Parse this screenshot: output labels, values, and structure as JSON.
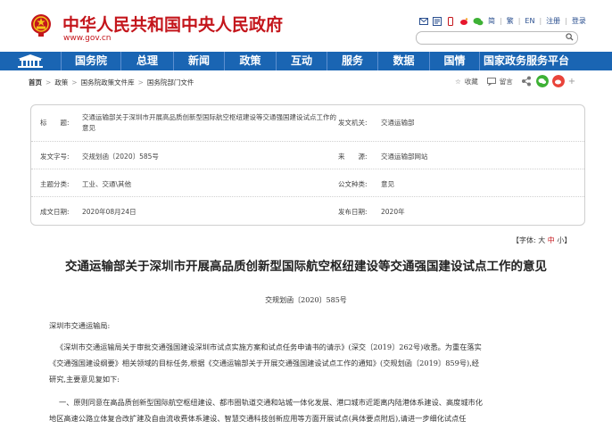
{
  "header": {
    "site_title": "中华人民共和国中央人民政府",
    "site_url": "www.gov.cn",
    "top_links": [
      "简",
      "繁",
      "EN",
      "注册",
      "登录"
    ]
  },
  "nav": {
    "items": [
      "国务院",
      "总理",
      "新闻",
      "政策",
      "互动",
      "服务",
      "数据",
      "国情",
      "国家政务服务平台"
    ]
  },
  "breadcrumb": {
    "items": [
      "首页",
      "政策",
      "国务院政策文件库",
      "国务院部门文件"
    ]
  },
  "share": {
    "favorite": "收藏",
    "comment": "留言"
  },
  "meta": {
    "title_label": "标　　题:",
    "title_value": "交通运输部关于深圳市开展高品质创新型国际航空枢纽建设等交通强国建设试点工作的意见",
    "issuer_label": "发文机关:",
    "issuer_value": "交通运输部",
    "docno_label": "发文字号:",
    "docno_value": "交规划函〔2020〕585号",
    "source_label": "来　　源:",
    "source_value": "交通运输部网站",
    "topic_label": "主题分类:",
    "topic_value": "工业、交通\\其他",
    "category_label": "公文种类:",
    "category_value": "意见",
    "written_label": "成文日期:",
    "written_value": "2020年08月24日",
    "published_label": "发布日期:",
    "published_value": "2020年"
  },
  "fontsize": {
    "prefix": "【字体:",
    "large": "大",
    "medium": "中",
    "small": "小",
    "suffix": "】"
  },
  "document": {
    "title": "交通运输部关于深圳市开展高品质创新型国际航空枢纽建设等交通强国建设试点工作的意见",
    "number": "交规划函〔2020〕585号",
    "salutation": "深圳市交通运输局:",
    "para1_line1": "《深圳市交通运输局关于审批交通强国建设深圳市试点实施方案和试点任务申请书的请示》(深交〔2019〕262号)收悉。为重在落实",
    "para1_line2": "《交通强国建设纲要》相关领域的目标任务,根据《交通运输部关于开展交通强国建设试点工作的通知》(交规划函〔2019〕859号),经",
    "para1_line3": "研究,主要意见复如下:",
    "para2_line1": "一、原则同意在高品质创新型国际航空枢纽建设、都市圈轨道交通和站城一体化发展、港口城市近距离内陆港体系建设、高度城市化",
    "para2_line2": "地区高速公路立体复合改扩建及自由流收费体系建设、智慧交通科技创新应用等方面开展试点(具体要点附后),请进一步细化试点任"
  },
  "colors": {
    "brand_red": "#c4161c",
    "nav_blue": "#1a65b3"
  }
}
